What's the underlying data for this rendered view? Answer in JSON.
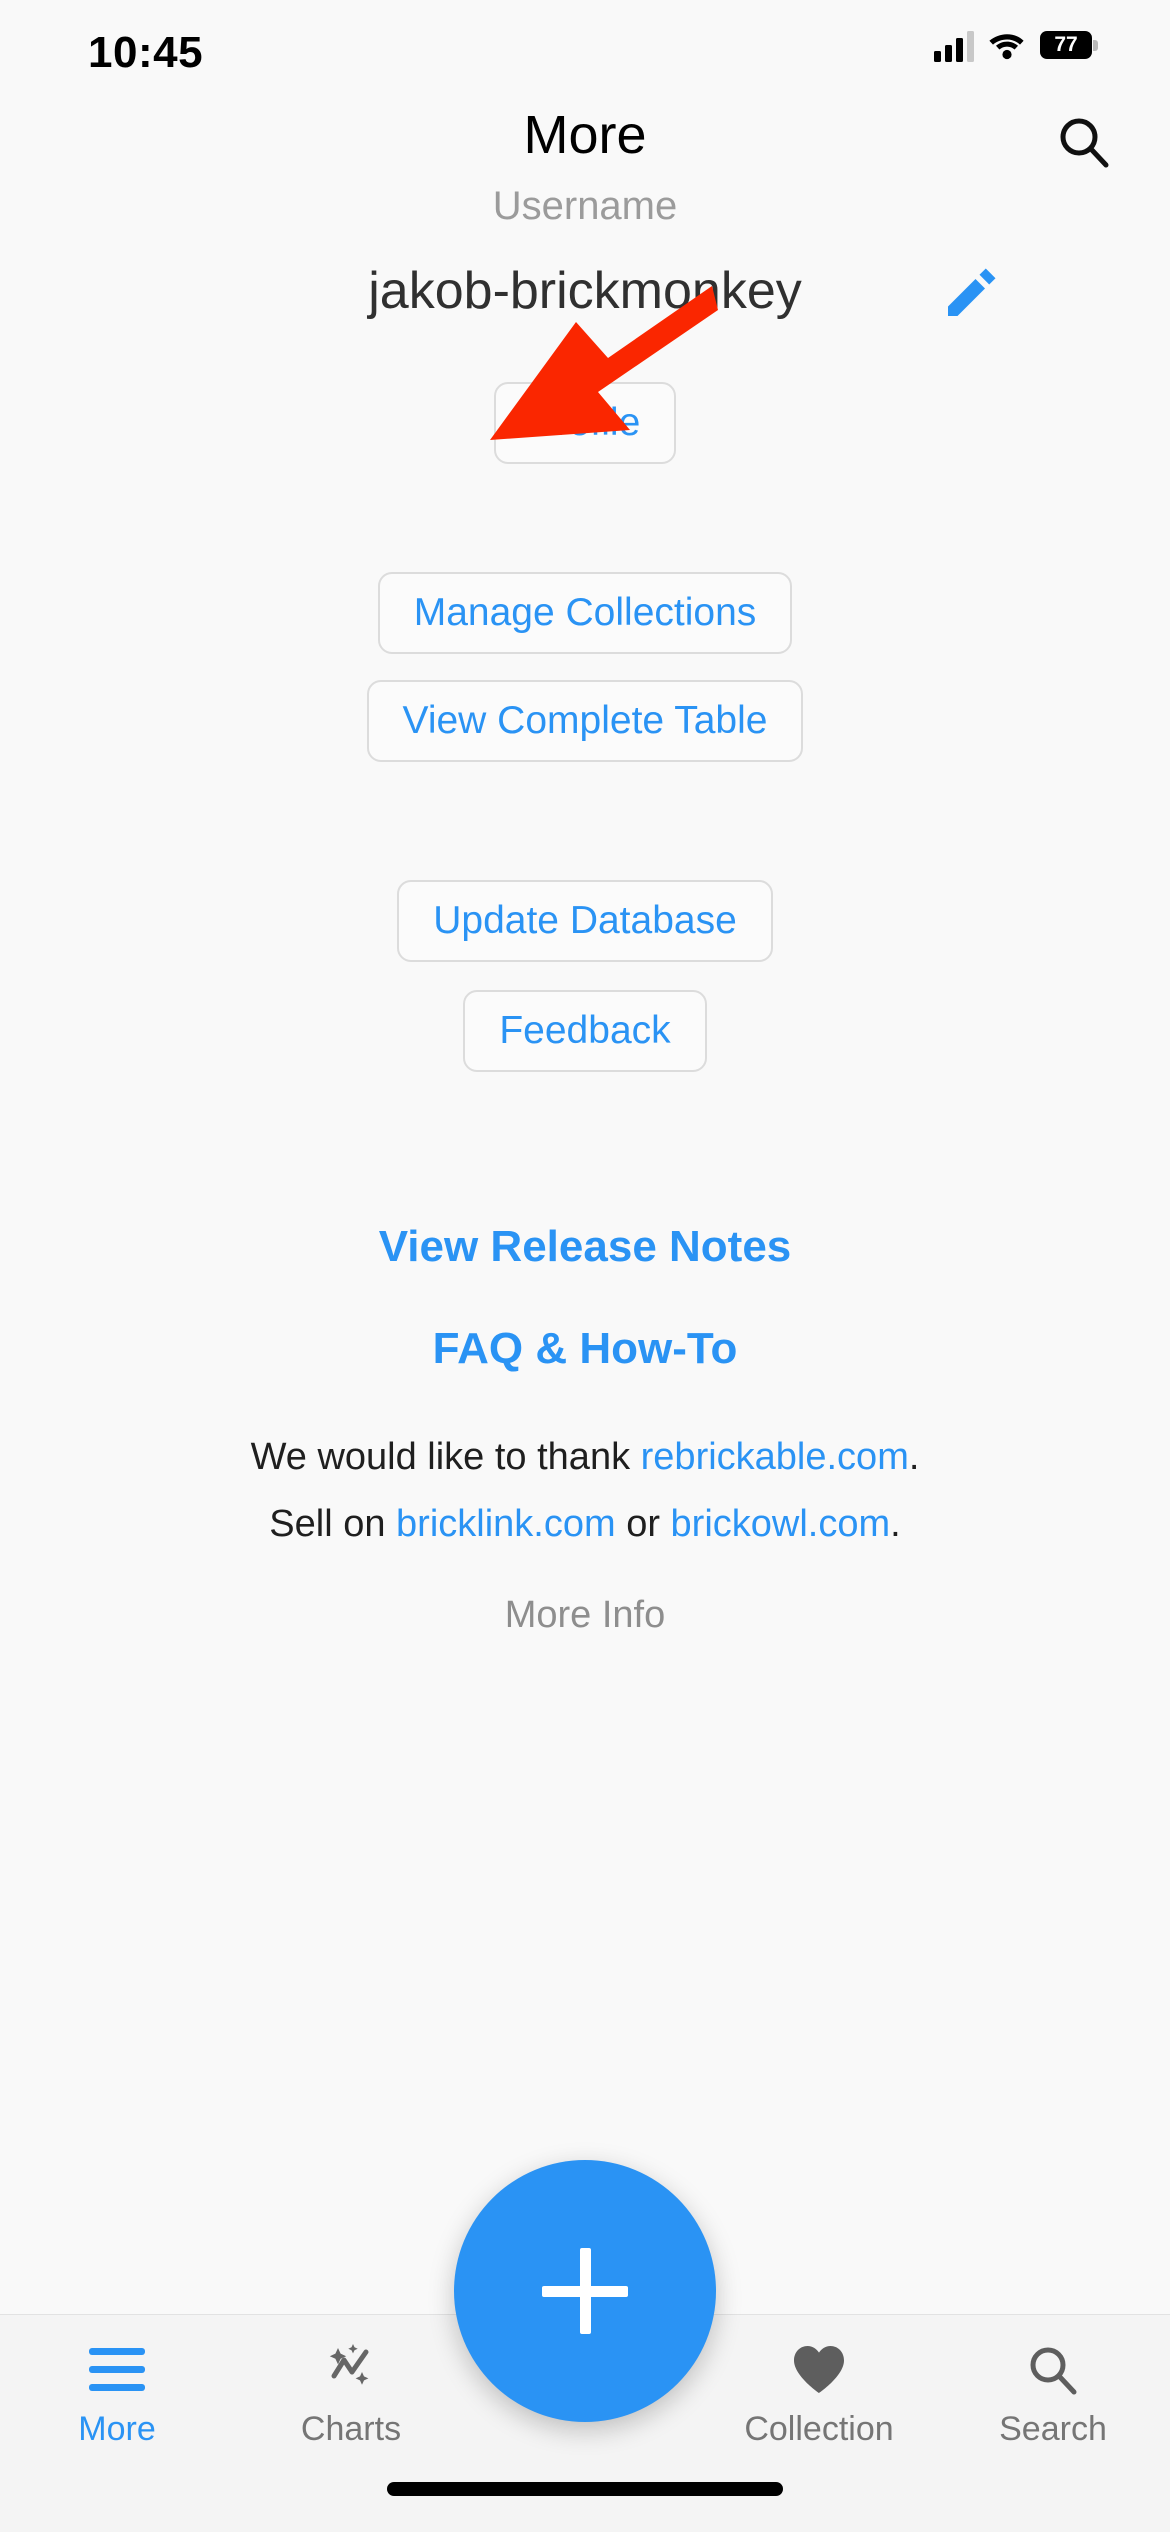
{
  "status_bar": {
    "time": "10:45",
    "battery_percent": "77",
    "icons": [
      "cellular-signal-icon",
      "wifi-icon",
      "battery-icon"
    ]
  },
  "header": {
    "title": "More",
    "search_icon": "search-icon"
  },
  "profile_section": {
    "username_label": "Username",
    "username_value": "jakob-brickmonkey",
    "edit_icon": "pencil-icon",
    "profile_button": "Profile"
  },
  "actions": {
    "manage_collections": "Manage Collections",
    "view_complete_table": "View Complete Table",
    "update_database": "Update Database",
    "feedback": "Feedback"
  },
  "links": {
    "release_notes": "View Release Notes",
    "faq": "FAQ & How-To"
  },
  "credits": {
    "line1_prefix": "We would like to thank ",
    "line1_link": "rebrickable.com",
    "line1_suffix": ".",
    "line2_prefix": "Sell on ",
    "line2_link1": "bricklink.com",
    "line2_middle": " or ",
    "line2_link2": "brickowl.com",
    "line2_suffix": ".",
    "more_info": "More Info"
  },
  "fab": {
    "icon": "plus-icon"
  },
  "tabbar": {
    "items": [
      {
        "label": "More",
        "icon": "hamburger-menu-icon",
        "active": true
      },
      {
        "label": "Charts",
        "icon": "sparkle-chart-icon",
        "active": false
      },
      {
        "label": "Collection",
        "icon": "heart-icon",
        "active": false
      },
      {
        "label": "Search",
        "icon": "search-icon",
        "active": false
      }
    ]
  },
  "annotation": {
    "arrow_color": "#fa2600",
    "points_at": "Manage Collections"
  },
  "colors": {
    "accent_blue": "#2a93f4",
    "page_background": "#f9f9f9",
    "tabbar_background": "#f4f4f4",
    "muted_text": "#8e8e8e",
    "border": "#dcdcdc"
  }
}
